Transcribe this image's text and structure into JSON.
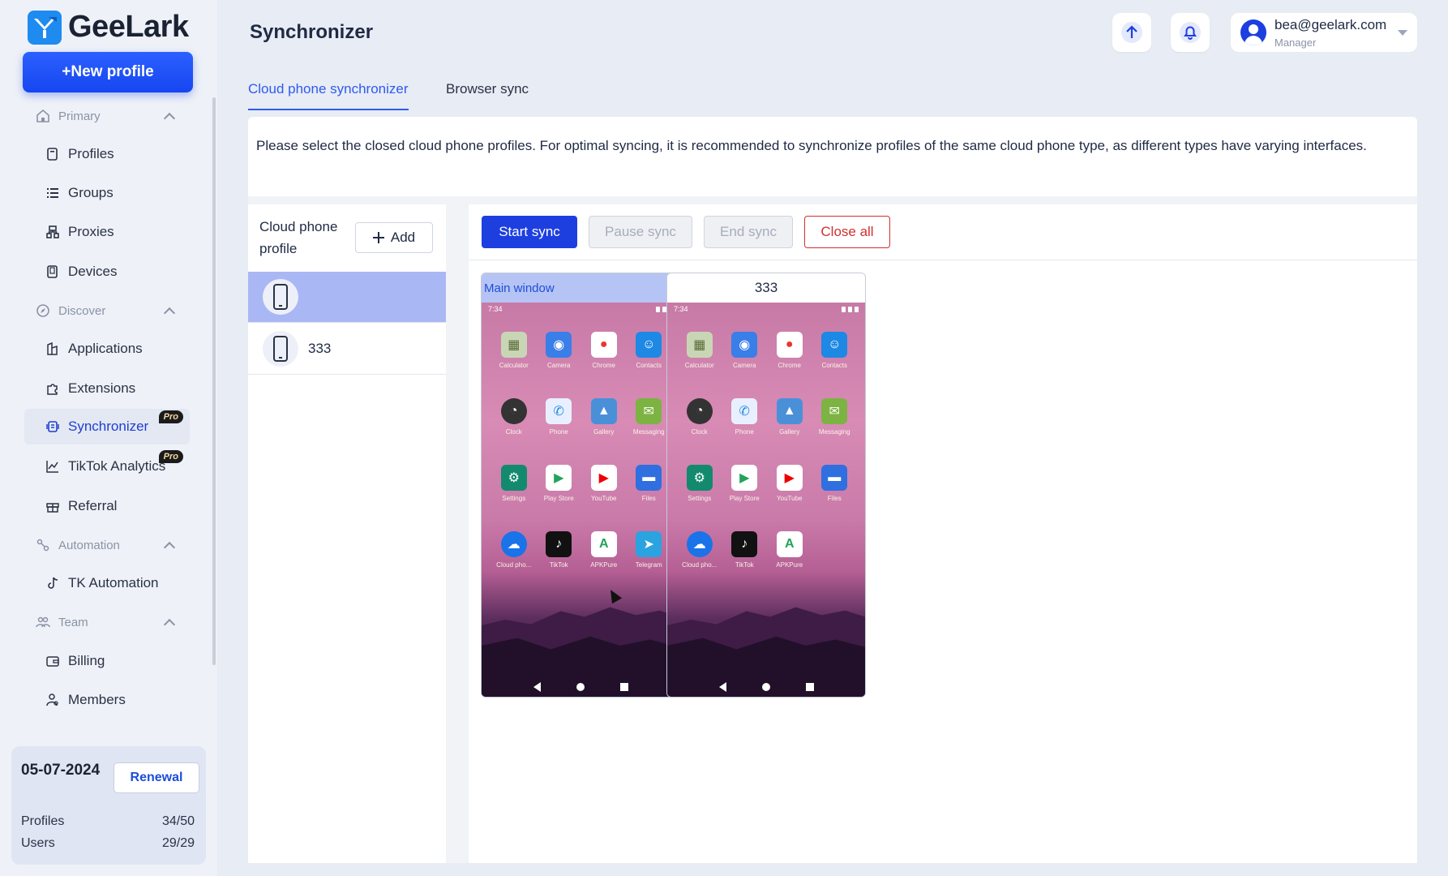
{
  "app": {
    "name": "GeeLark",
    "page_title": "Synchronizer"
  },
  "sidebar": {
    "new_profile_label": "+New profile",
    "sections": [
      {
        "label": "Primary",
        "items": [
          "Profiles",
          "Groups",
          "Proxies",
          "Devices"
        ]
      },
      {
        "label": "Discover",
        "items": [
          "Applications",
          "Extensions",
          "Synchronizer",
          "TikTok Analytics",
          "Referral"
        ]
      },
      {
        "label": "Automation",
        "items": [
          "TK Automation"
        ]
      },
      {
        "label": "Team",
        "items": [
          "Billing",
          "Members"
        ]
      }
    ],
    "active_item": "Synchronizer",
    "pro_badge": "Pro"
  },
  "plan": {
    "date": "05-07-2024",
    "renewal_label": "Renewal",
    "profiles_label": "Profiles",
    "profiles_value": "34/50",
    "users_label": "Users",
    "users_value": "29/29"
  },
  "header": {
    "user_email": "bea@geelark.com",
    "user_role": "Manager"
  },
  "tabs": [
    {
      "label": "Cloud phone synchronizer",
      "active": true
    },
    {
      "label": "Browser sync",
      "active": false
    }
  ],
  "info_text": "Please select the closed cloud phone profiles. For optimal syncing, it is recommended to synchronize profiles of the same cloud phone type, as different types have varying interfaces.",
  "profile_pane": {
    "label": "Cloud phone profile",
    "add_label": "Add",
    "profiles": [
      {
        "name": "",
        "selected": true
      },
      {
        "name": "333",
        "selected": false
      }
    ]
  },
  "toolbar": {
    "start_label": "Start sync",
    "pause_label": "Pause sync",
    "end_label": "End sync",
    "close_all_label": "Close all"
  },
  "phones": [
    {
      "title": "Main window",
      "time": "7:34",
      "apps": [
        "Calculator",
        "Camera",
        "Chrome",
        "Contacts",
        "Clock",
        "Phone",
        "Gallery",
        "Messaging",
        "Settings",
        "Play Store",
        "YouTube",
        "Files",
        "Cloud pho...",
        "TikTok",
        "APKPure",
        "Telegram"
      ]
    },
    {
      "title": "333",
      "time": "7:34",
      "apps": [
        "Calculator",
        "Camera",
        "Chrome",
        "Contacts",
        "Clock",
        "Phone",
        "Gallery",
        "Messaging",
        "Settings",
        "Play Store",
        "YouTube",
        "Files",
        "Cloud pho...",
        "TikTok",
        "APKPure"
      ]
    }
  ],
  "app_icon_colors": {
    "Calculator": "#c9d6b5",
    "Camera": "#3a7ee8",
    "Chrome": "#ffffff",
    "Contacts": "#1e88e5",
    "Clock": "#333333",
    "Phone": "#e8f0ff",
    "Gallery": "#4a90d9",
    "Messaging": "#7cb342",
    "Settings": "#138a6e",
    "Play Store": "#ffffff",
    "YouTube": "#ffffff",
    "Files": "#2f6fe0",
    "Cloud pho...": "#1a73e8",
    "TikTok": "#111111",
    "APKPure": "#ffffff",
    "Telegram": "#2aa3e0"
  },
  "colors": {
    "accent": "#1d3fe0",
    "danger": "#d32f2f",
    "selected_row": "#aab7f5"
  }
}
